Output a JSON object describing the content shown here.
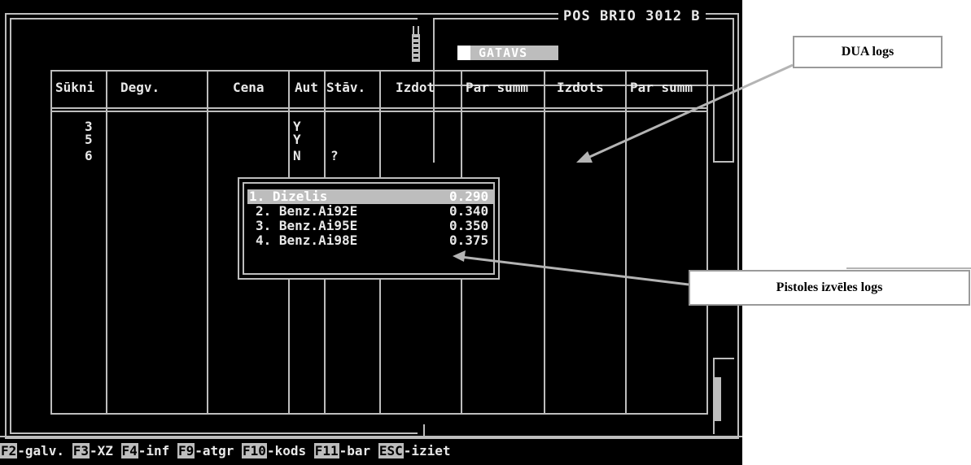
{
  "header": {
    "title": "POS BRIO 3012 B",
    "status": "GATAVS"
  },
  "table": {
    "columns": [
      "Sūkni",
      "Degv.",
      "Cena",
      "Aut",
      "Stāv.",
      "Izdot",
      "Par summ",
      "Izdots",
      "Par summ"
    ],
    "rows": [
      {
        "pump": "3",
        "aut": "Y",
        "stav": ""
      },
      {
        "pump": "5",
        "aut": "Y",
        "stav": ""
      },
      {
        "pump": "6",
        "aut": "N",
        "stav": "?"
      }
    ]
  },
  "nozzle_menu": {
    "items": [
      {
        "label": "1. Dizelis",
        "price": "0.290",
        "selected": true
      },
      {
        "label": "2. Benz.Ai92E",
        "price": "0.340",
        "selected": false
      },
      {
        "label": "3. Benz.Ai95E",
        "price": "0.350",
        "selected": false
      },
      {
        "label": "4. Benz.Ai98E",
        "price": "0.375",
        "selected": false
      }
    ]
  },
  "function_keys": [
    {
      "key": "F2",
      "label": "-galv."
    },
    {
      "key": "F3",
      "label": "-XZ"
    },
    {
      "key": "F4",
      "label": "-inf"
    },
    {
      "key": "F9",
      "label": "-atgr"
    },
    {
      "key": "F10",
      "label": "-kods"
    },
    {
      "key": "F11",
      "label": "-bar"
    },
    {
      "key": "ESC",
      "label": "-iziet"
    }
  ],
  "annotations": {
    "dua_label": "DUA logs",
    "nozzle_label": "Pistoles izvēles logs"
  },
  "colors": {
    "screen_bg": "#000000",
    "text": "#e8e8e8",
    "line": "#bdbdbd",
    "highlight": "#bdbdbd"
  }
}
